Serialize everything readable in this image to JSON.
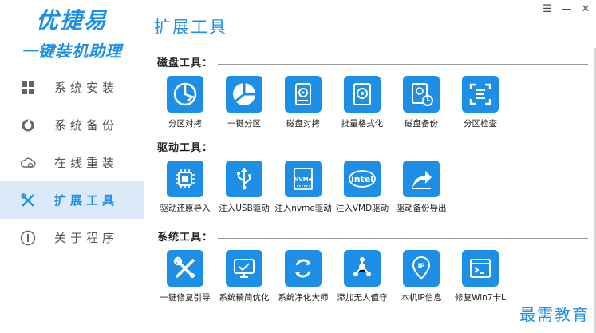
{
  "app": {
    "brand_line1": "优捷易",
    "brand_line2": "一键装机助理"
  },
  "window": {
    "menu": "☰",
    "minimize": "—",
    "close": "✕"
  },
  "sidebar": {
    "items": [
      {
        "label": "系统安装",
        "icon": "windows-icon",
        "active": false
      },
      {
        "label": "系统备份",
        "icon": "backup-icon",
        "active": false
      },
      {
        "label": "在线重装",
        "icon": "cloud-icon",
        "active": false
      },
      {
        "label": "扩展工具",
        "icon": "tools-icon",
        "active": true
      },
      {
        "label": "关于程序",
        "icon": "info-icon",
        "active": false
      }
    ]
  },
  "page": {
    "title": "扩展工具"
  },
  "sections": [
    {
      "title": "磁盘工具：",
      "tools": [
        {
          "label": "分区对拷",
          "icon": "partition-copy-icon"
        },
        {
          "label": "一键分区",
          "icon": "pie-partition-icon"
        },
        {
          "label": "磁盘对拷",
          "icon": "disk-copy-icon"
        },
        {
          "label": "批量格式化",
          "icon": "batch-format-icon"
        },
        {
          "label": "磁盘备份",
          "icon": "disk-backup-icon"
        },
        {
          "label": "分区检查",
          "icon": "partition-check-icon"
        }
      ]
    },
    {
      "title": "驱动工具：",
      "tools": [
        {
          "label": "驱动还原导入",
          "icon": "chip-icon"
        },
        {
          "label": "注入USB驱动",
          "icon": "usb-icon"
        },
        {
          "label": "注入nvme驱动",
          "icon": "nvme-icon"
        },
        {
          "label": "注入VMD驱动",
          "icon": "intel-icon"
        },
        {
          "label": "驱动备份导出",
          "icon": "export-icon"
        }
      ]
    },
    {
      "title": "系统工具：",
      "tools": [
        {
          "label": "一键修复引导",
          "icon": "repair-icon"
        },
        {
          "label": "系统精简优化",
          "icon": "optimize-icon"
        },
        {
          "label": "系统净化大师",
          "icon": "clean-icon"
        },
        {
          "label": "添加无人值守",
          "icon": "share-node-icon"
        },
        {
          "label": "本机IP信息",
          "icon": "ip-location-icon"
        },
        {
          "label": "修复Win7卡L",
          "icon": "console-icon"
        }
      ]
    }
  ],
  "nvme_text": "NVMe",
  "intel_text": "intel",
  "ip_text": "IP",
  "watermark": "最需教育",
  "colors": {
    "accent": "#1d8fe6",
    "active_bg": "#dce9f8"
  }
}
